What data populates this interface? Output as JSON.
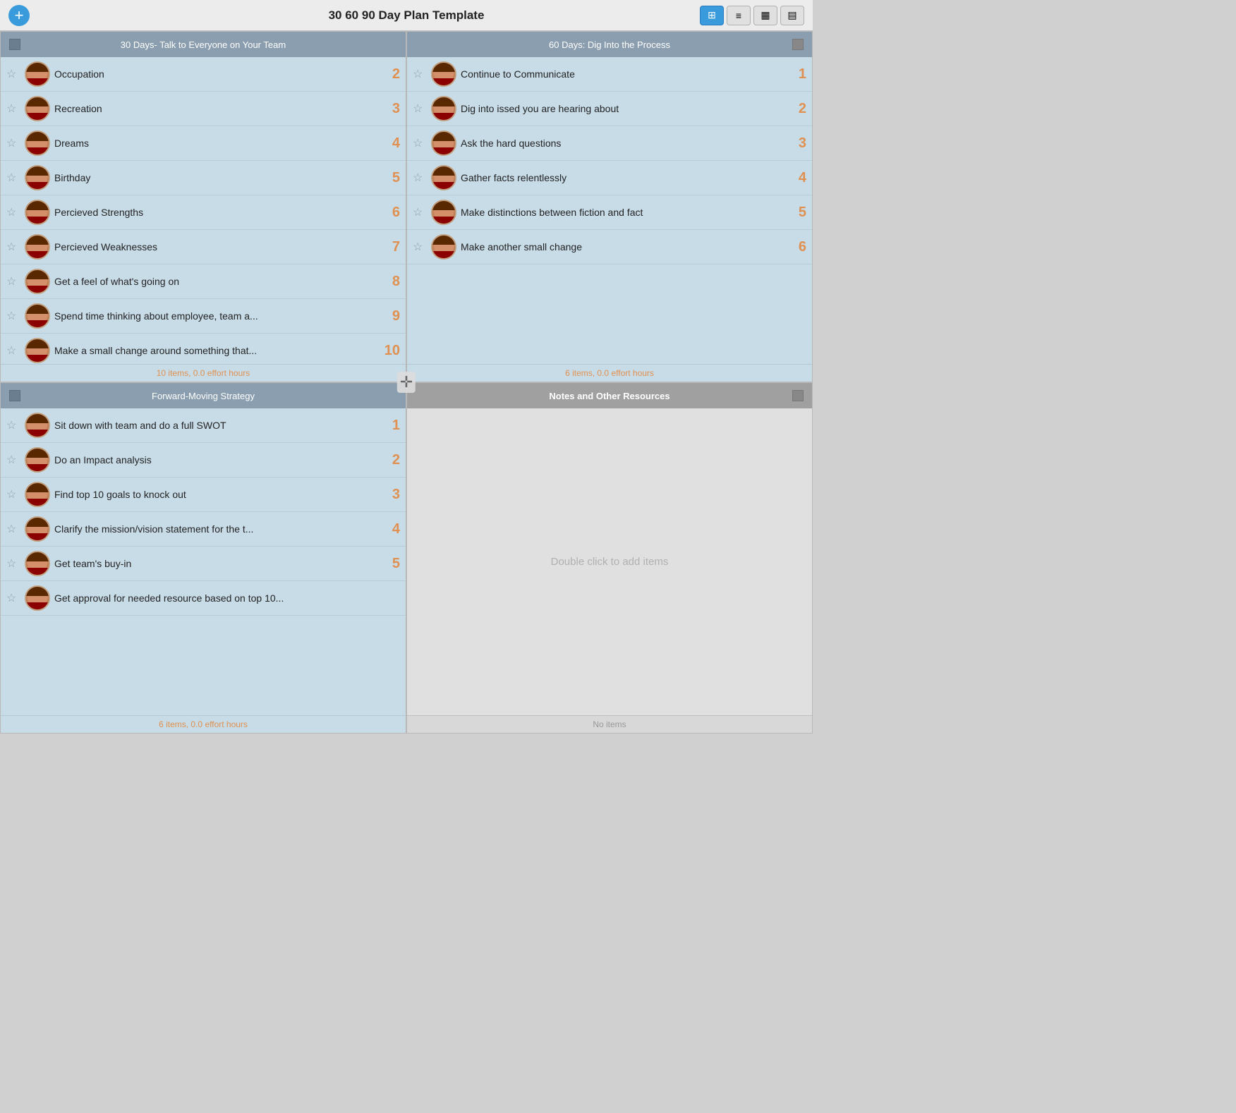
{
  "window": {
    "title": "30 60 90 Day Plan Template"
  },
  "toolbar": {
    "add_label": "+",
    "buttons": [
      {
        "id": "grid",
        "icon": "⊞",
        "active": true
      },
      {
        "id": "list",
        "icon": "≡",
        "active": false
      },
      {
        "id": "calendar",
        "icon": "▦",
        "active": false
      },
      {
        "id": "chart",
        "icon": "▤",
        "active": false
      }
    ]
  },
  "quadrants": [
    {
      "id": "q1",
      "title": "30 Days- Talk to Everyone on Your Team",
      "footer": "10 items, 0.0 effort hours",
      "notes_body": false,
      "items": [
        {
          "text": "Occupation",
          "number": "2"
        },
        {
          "text": "Recreation",
          "number": "3"
        },
        {
          "text": "Dreams",
          "number": "4"
        },
        {
          "text": "Birthday",
          "number": "5"
        },
        {
          "text": "Percieved Strengths",
          "number": "6"
        },
        {
          "text": "Percieved Weaknesses",
          "number": "7"
        },
        {
          "text": "Get a feel of what's going on",
          "number": "8"
        },
        {
          "text": "Spend time thinking about employee, team a...",
          "number": "9"
        },
        {
          "text": "Make a small change around something that...",
          "number": "10"
        }
      ]
    },
    {
      "id": "q2",
      "title": "60 Days: Dig Into the Process",
      "footer": "6 items, 0.0 effort hours",
      "notes_body": false,
      "items": [
        {
          "text": "Continue to Communicate",
          "number": "1"
        },
        {
          "text": "Dig into issed you are hearing about",
          "number": "2"
        },
        {
          "text": "Ask the hard questions",
          "number": "3"
        },
        {
          "text": "Gather facts relentlessly",
          "number": "4"
        },
        {
          "text": "Make distinctions between fiction and fact",
          "number": "5"
        },
        {
          "text": "Make another small change",
          "number": "6"
        }
      ]
    },
    {
      "id": "q3",
      "title": "Forward-Moving Strategy",
      "footer": "6 items, 0.0 effort hours",
      "notes_body": false,
      "items": [
        {
          "text": "Sit down with team and do a full SWOT",
          "number": "1"
        },
        {
          "text": "Do an Impact analysis",
          "number": "2"
        },
        {
          "text": "Find top 10 goals to knock out",
          "number": "3"
        },
        {
          "text": "Clarify the mission/vision statement for the t...",
          "number": "4"
        },
        {
          "text": "Get team's buy-in",
          "number": "5"
        },
        {
          "text": "Get approval for needed resource based on top 10...",
          "number": ""
        }
      ]
    },
    {
      "id": "q4",
      "title": "Notes and Other Resources",
      "footer": "No items",
      "notes_body": true,
      "notes_placeholder": "Double click to add items",
      "items": []
    }
  ],
  "divider_icon": "✛"
}
